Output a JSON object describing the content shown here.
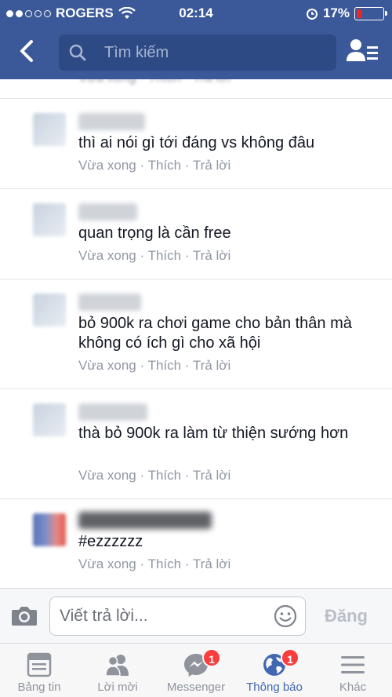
{
  "status": {
    "carrier": "ROGERS",
    "time": "02:14",
    "battery": "17%"
  },
  "header": {
    "search_placeholder": "Tìm kiếm"
  },
  "comments": [
    {
      "text": "thì ai nói gì tới đáng vs không đâu",
      "actions": {
        "time": "Vừa xong",
        "like": "Thích",
        "reply": "Trả lời"
      }
    },
    {
      "text": "quan trọng là cần free",
      "actions": {
        "time": "Vừa xong",
        "like": "Thích",
        "reply": "Trả lời"
      }
    },
    {
      "text": "bỏ 900k ra chơi game cho bản thân mà không có ích gì cho xã hội",
      "actions": {
        "time": "Vừa xong",
        "like": "Thích",
        "reply": "Trả lời"
      }
    },
    {
      "text": "thà bỏ 900k ra làm từ thiện sướng hơn",
      "actions": {
        "time": "Vừa xong",
        "like": "Thích",
        "reply": "Trả lời"
      }
    },
    {
      "text": "#ezzzzzz",
      "actions": {
        "time": "Vừa xong",
        "like": "Thích",
        "reply": "Trả lời"
      }
    }
  ],
  "reply_bar": {
    "placeholder": "Viết trả lời...",
    "post_label": "Đăng"
  },
  "tabs": [
    {
      "label": "Bảng tin",
      "icon": "news-feed-icon"
    },
    {
      "label": "Lời mời",
      "icon": "friend-requests-icon"
    },
    {
      "label": "Messenger",
      "icon": "messenger-icon",
      "badge": "1"
    },
    {
      "label": "Thông báo",
      "icon": "globe-icon",
      "badge": "1",
      "active": true
    },
    {
      "label": "Khác",
      "icon": "menu-icon"
    }
  ],
  "colors": {
    "brand": "#3b5998",
    "active_tab": "#4267b2",
    "badge": "#fa3e3e",
    "meta": "#9197a3"
  }
}
